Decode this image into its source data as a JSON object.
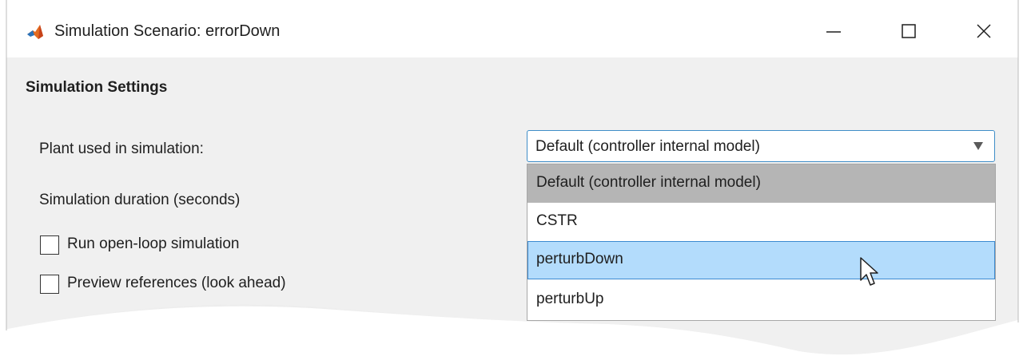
{
  "window": {
    "title": "Simulation Scenario: errorDown",
    "app_icon": "matlab-icon",
    "controls": [
      "minimize-icon",
      "maximize-icon",
      "close-icon"
    ]
  },
  "settings": {
    "section_title": "Simulation Settings",
    "plant_label": "Plant used in simulation:",
    "duration_label": "Simulation duration (seconds)",
    "open_loop_label": "Run open-loop simulation",
    "open_loop_checked": false,
    "preview_label": "Preview references (look ahead)",
    "preview_checked": false
  },
  "plant_select": {
    "selected": "Default (controller internal model)",
    "options": [
      "Default (controller internal model)",
      "CSTR",
      "perturbDown",
      "perturbUp"
    ],
    "hovered_index": 2,
    "colors": {
      "selected_bg": "#b5b5b5",
      "hover_bg": "#b3dcfc",
      "hover_border": "#3c8ad0",
      "focus_border": "#3f8ec8"
    }
  }
}
